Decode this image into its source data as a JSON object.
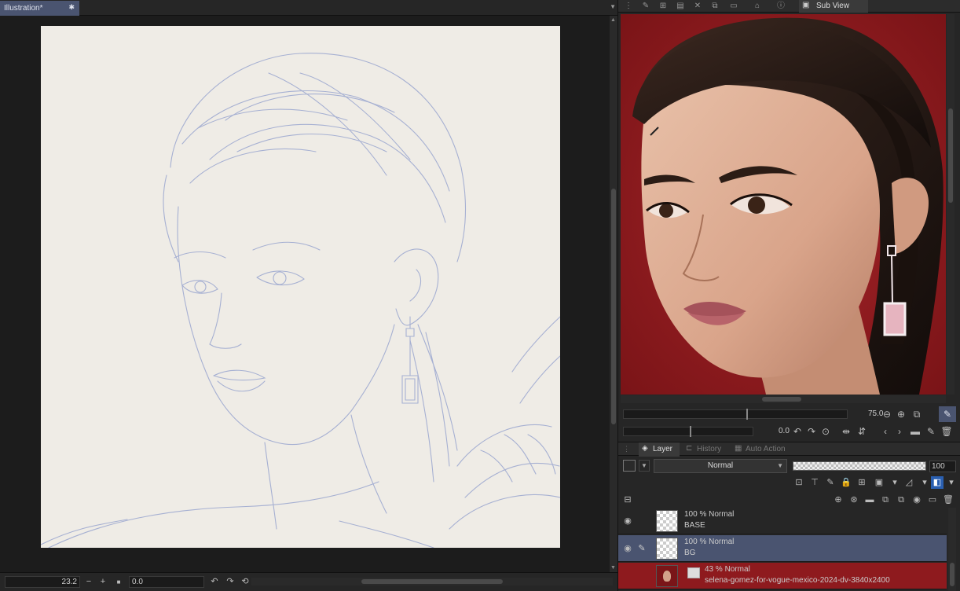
{
  "document": {
    "tab_title": "Illustration*",
    "tab_close": "✱"
  },
  "statusbar": {
    "zoom": "23.2",
    "zoom_out": "−",
    "zoom_in": "+",
    "fit": "■",
    "rotation": "0.0",
    "rotate_left": "↶",
    "rotate_right": "↷",
    "reset": "⟲"
  },
  "subview": {
    "tab_label": "Sub View",
    "zoom_value": "75.0",
    "rotation_value": "0.0"
  },
  "layer_panel": {
    "tabs": [
      {
        "label": "Layer",
        "icon": "layers-icon"
      },
      {
        "label": "History",
        "icon": "history-icon"
      },
      {
        "label": "Auto Action",
        "icon": "auto-action-icon"
      }
    ],
    "blend_mode": "Normal",
    "opacity": "100",
    "layers": [
      {
        "mode": "100 % Normal",
        "name": "BASE",
        "selected": false
      },
      {
        "mode": "100 % Normal",
        "name": "BG",
        "selected": true
      },
      {
        "mode": "43 % Normal",
        "name": "selena-gomez-for-vogue-mexico-2024-dv-3840x2400",
        "selected": false
      }
    ]
  },
  "colors": {
    "accent": "#4a5470",
    "panel_bg": "#262626",
    "paper": "#efece6",
    "sketch_line": "#8f9cc8",
    "photo_bg": "#8e1a1e"
  }
}
